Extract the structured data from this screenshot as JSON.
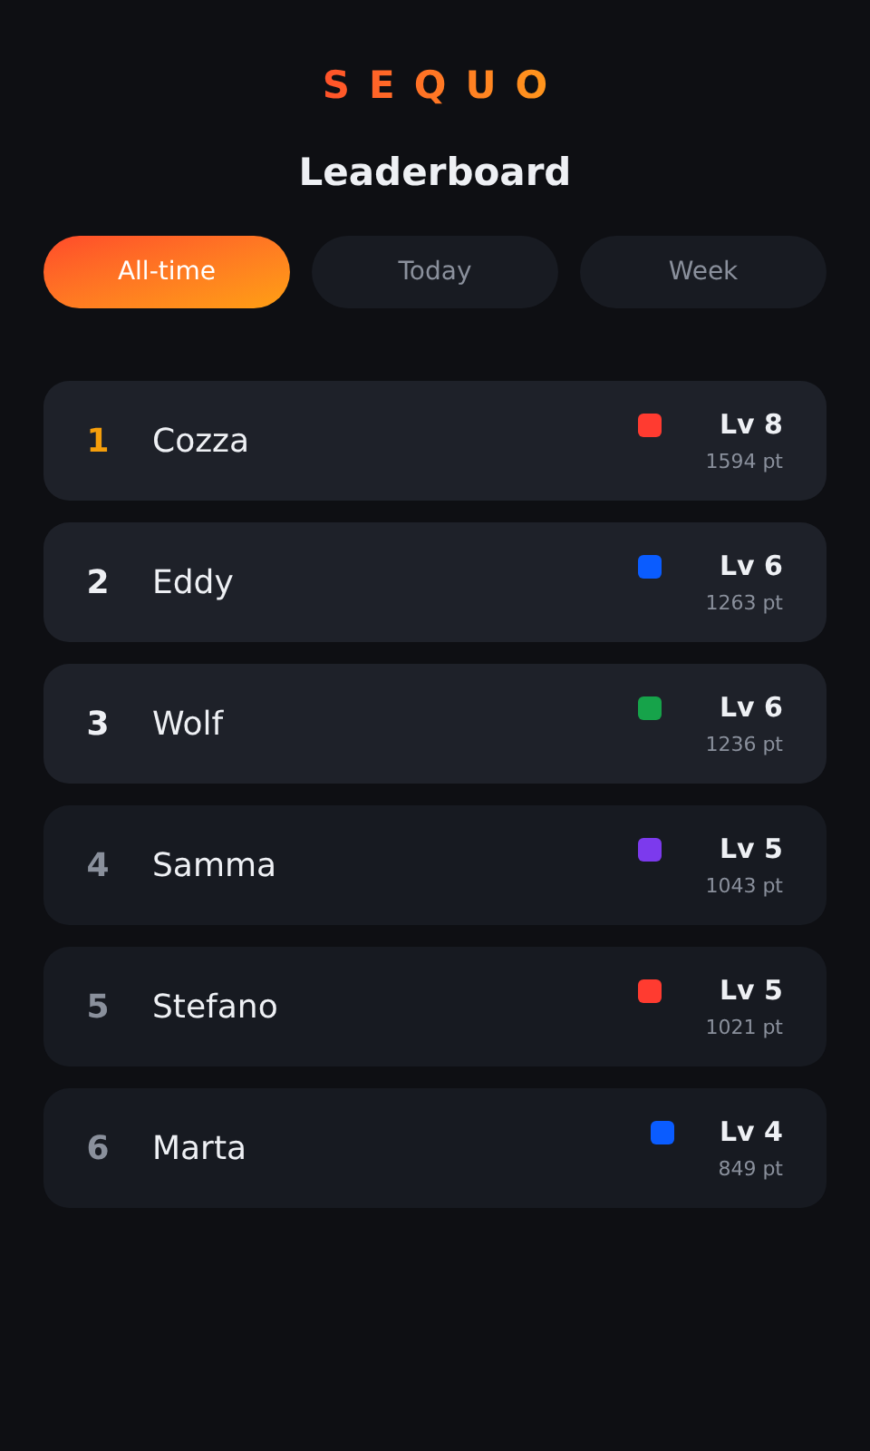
{
  "logo": "SEQUO",
  "title": "Leaderboard",
  "tabs": [
    {
      "label": "All-time",
      "selected": true
    },
    {
      "label": "Today",
      "selected": false
    },
    {
      "label": "Week",
      "selected": false
    }
  ],
  "players": [
    {
      "rank": "1",
      "name": "Cozza",
      "kind": "first",
      "color": "#ff3b30",
      "level": "Lv 8",
      "points": "1594 pt"
    },
    {
      "rank": "2",
      "name": "Eddy",
      "kind": "top",
      "color": "#0a5cff",
      "level": "Lv 6",
      "points": "1263 pt"
    },
    {
      "rank": "3",
      "name": "Wolf",
      "kind": "top",
      "color": "#16a34a",
      "level": "Lv 6",
      "points": "1236 pt"
    },
    {
      "rank": "4",
      "name": "Samma",
      "kind": "rest",
      "color": "#7c3aed",
      "level": "Lv 5",
      "points": "1043 pt"
    },
    {
      "rank": "5",
      "name": "Stefano",
      "kind": "rest",
      "color": "#ff3b30",
      "level": "Lv 5",
      "points": "1021 pt"
    },
    {
      "rank": "6",
      "name": "Marta",
      "kind": "rest",
      "color": "#0a5cff",
      "level": "Lv 4",
      "points": "849 pt"
    }
  ]
}
